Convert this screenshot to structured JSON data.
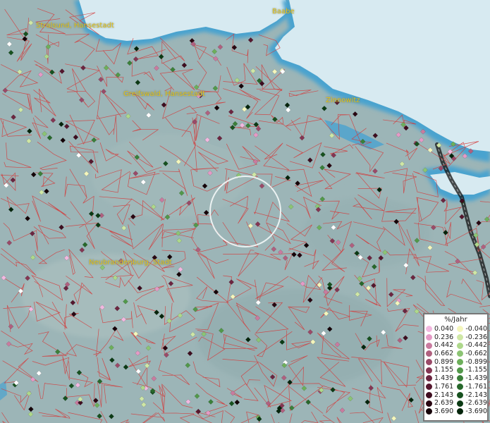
{
  "cities": [
    {
      "id": "baabe",
      "name": "Baabe"
    },
    {
      "id": "stralsund",
      "name": "Stralsund, Hansestadt"
    },
    {
      "id": "greifswald",
      "name": "Greifswald, Hansestadt"
    },
    {
      "id": "zinnowitz",
      "name": "Zinnowitz"
    },
    {
      "id": "neubrandenburg",
      "name": "Neubrandenburg, Stadt"
    }
  ],
  "legend": {
    "title": "%/Jahr",
    "positive": [
      {
        "label": "0.040",
        "color": "#f2b8e0"
      },
      {
        "label": "0.236",
        "color": "#e59ac6"
      },
      {
        "label": "0.442",
        "color": "#c97b9f"
      },
      {
        "label": "0.662",
        "color": "#b0607f"
      },
      {
        "label": "0.899",
        "color": "#9a4a68"
      },
      {
        "label": "1.155",
        "color": "#843653"
      },
      {
        "label": "1.439",
        "color": "#6c2540"
      },
      {
        "label": "1.761",
        "color": "#55172e"
      },
      {
        "label": "2.143",
        "color": "#3e0d1f"
      },
      {
        "label": "2.639",
        "color": "#290611"
      },
      {
        "label": "3.690",
        "color": "#150208"
      }
    ],
    "negative": [
      {
        "label": "-0.040",
        "color": "#f4f6bc"
      },
      {
        "label": "-0.236",
        "color": "#cfe7a5"
      },
      {
        "label": "-0.442",
        "color": "#aed88b"
      },
      {
        "label": "-0.662",
        "color": "#8cc474"
      },
      {
        "label": "-0.899",
        "color": "#6daf5b"
      },
      {
        "label": "-1.155",
        "color": "#52984a"
      },
      {
        "label": "-1.439",
        "color": "#3b803a"
      },
      {
        "label": "-1.761",
        "color": "#27682b"
      },
      {
        "label": "-2.143",
        "color": "#17511f"
      },
      {
        "label": "-2.639",
        "color": "#0b3a14"
      },
      {
        "label": "-3.690",
        "color": "#04240b"
      }
    ]
  },
  "colors": {
    "land": "#9cb5b7",
    "sea": "#d7eaf1",
    "coast": "#4aa3cf",
    "borders": "#d43a3a",
    "label": "#e3c21a",
    "white_point": "#ffffff"
  }
}
